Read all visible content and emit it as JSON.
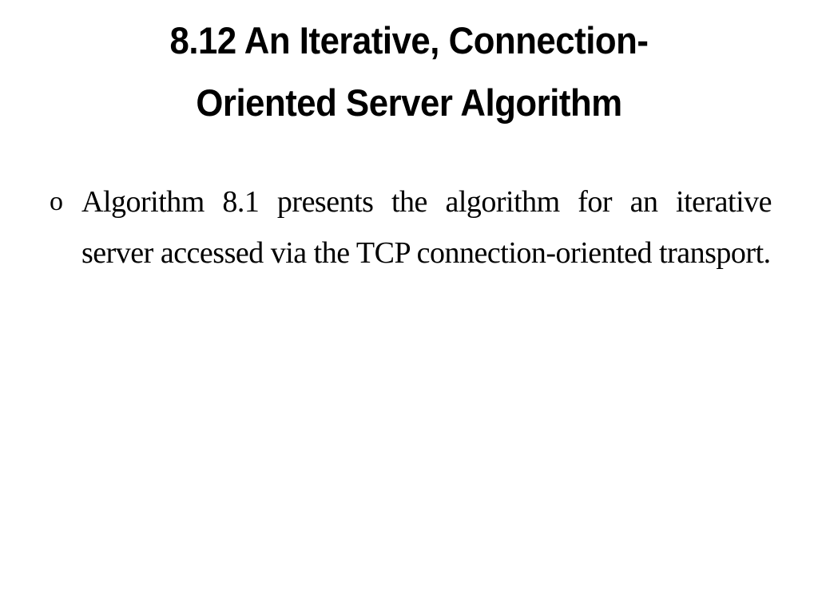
{
  "slide": {
    "title_line1": "8.12 An Iterative, Connection-",
    "title_line2": "Oriented Server Algorithm",
    "bullets": [
      {
        "marker": "o",
        "text": "Algorithm 8.1 presents the algorithm for an iterative server accessed via the TCP connection-oriented transport."
      }
    ]
  }
}
